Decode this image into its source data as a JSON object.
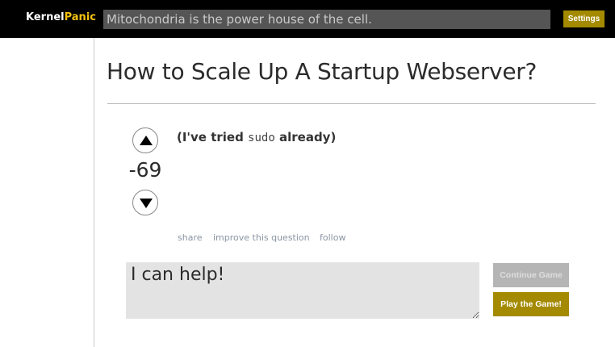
{
  "topbar": {
    "logo_prefix": "Kernel",
    "logo_accent": "Panic",
    "search_value": "Mitochondria is the power house of the cell.",
    "settings_label": "Settings"
  },
  "question": {
    "title": "How to Scale Up A Startup Webserver?",
    "body_prefix": "(I've tried ",
    "body_code": "sudo",
    "body_suffix": " already)",
    "vote_count": "-69"
  },
  "post_menu": {
    "share": "share",
    "improve": "improve this question",
    "follow": "follow"
  },
  "answer": {
    "value": "I can help!"
  },
  "game": {
    "continue_label": "Continue Game",
    "play_label": "Play the Game!"
  },
  "colors": {
    "topbar_bg": "#000000",
    "logo_accent": "#f2c10f",
    "button_gold": "#a38a00",
    "button_disabled": "#b5b5b5",
    "answer_bg": "#e3e3e3"
  },
  "icons": {
    "upvote": "triangle-up-icon",
    "downvote": "triangle-down-icon"
  }
}
